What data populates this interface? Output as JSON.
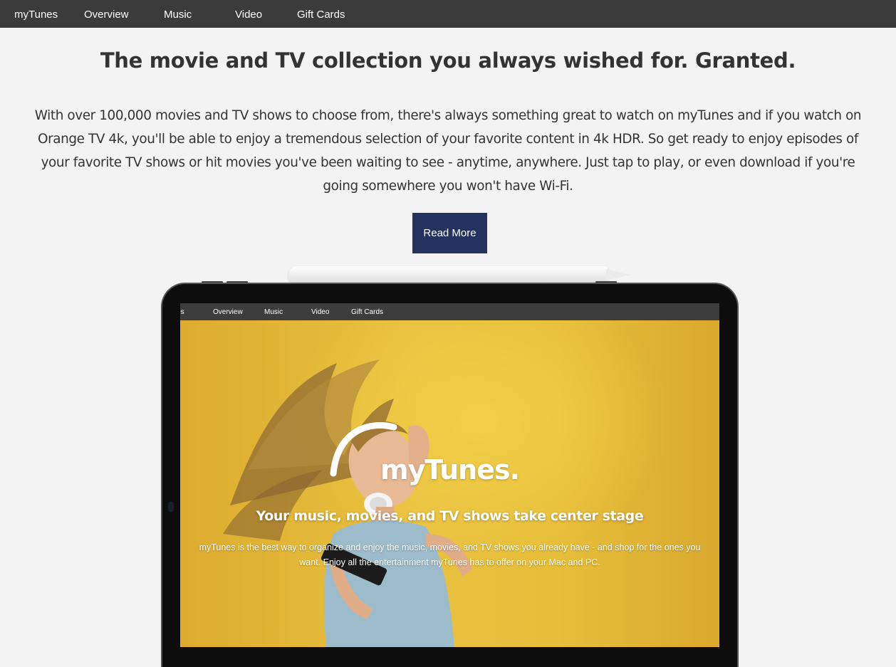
{
  "nav": {
    "brand": "myTunes",
    "items": [
      "Overview",
      "Music",
      "Video",
      "Gift Cards"
    ]
  },
  "intro": {
    "headline": "The movie and TV collection you always wished for. Granted.",
    "body": "With over 100,000 movies and TV shows to choose from, there's always something great to watch on myTunes and if you watch on Orange TV 4k, you'll be able to enjoy a tremendous selection of your favorite content in 4k HDR. So get ready to enjoy episodes of your favorite TV shows or hit movies you've been waiting to see - anytime, anywhere. Just tap to play, or even download if you're going somewhere you won't have Wi-Fi.",
    "button_label": "Read More"
  },
  "device_screen": {
    "nav": {
      "brand": "unes",
      "items": [
        "Overview",
        "Music",
        "Video",
        "Gift Cards"
      ]
    },
    "hero": {
      "title": "myTunes.",
      "subtitle": "Your music, movies, and TV shows take center stage",
      "body": "myTunes is the best way to organize and enjoy the music, movies, and TV shows you already have - and shop for the ones you want. Enjoy all the entertainment myTunes has to offer on your Mac and PC."
    }
  },
  "colors": {
    "nav_bg": "#3b3b3b",
    "page_bg": "#f3f3f3",
    "button_bg": "#23325f",
    "hero_bg": "#e4b73c"
  },
  "icons": [
    "stylus-pencil",
    "tablet-device",
    "front-camera"
  ]
}
